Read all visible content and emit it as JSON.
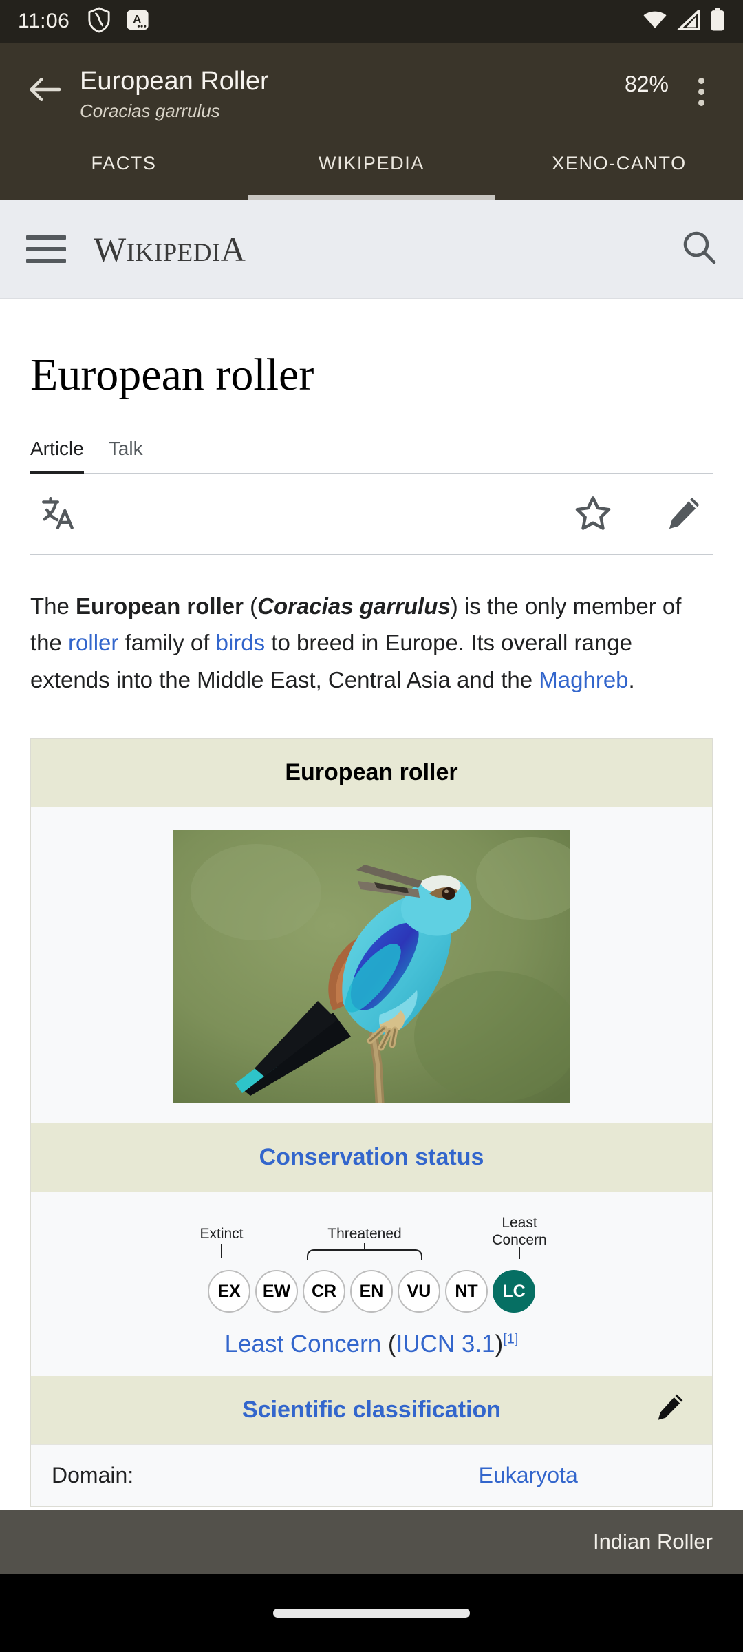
{
  "status_bar": {
    "time": "11:06",
    "icons": [
      "shield-icon",
      "keyboard-language-icon",
      "wifi-icon",
      "cellular-signal-icon",
      "battery-icon"
    ]
  },
  "app_bar": {
    "back_icon": "back-arrow-icon",
    "title": "European Roller",
    "subtitle": "Coracias garrulus",
    "battery_percent": "82%",
    "overflow_icon": "overflow-menu-icon"
  },
  "tabs": [
    {
      "label": "FACTS",
      "selected": false
    },
    {
      "label": "WIKIPEDIA",
      "selected": true
    },
    {
      "label": "XENO-CANTO",
      "selected": false
    }
  ],
  "wiki_header": {
    "menu_icon": "hamburger-menu-icon",
    "wordmark_main": "W",
    "wordmark_rest_a": "IKIPEDI",
    "wordmark_cap": "A",
    "wordmark_text": "WIKIPEDIA",
    "search_icon": "search-icon"
  },
  "article": {
    "title": "European roller",
    "tabs": [
      {
        "label": "Article",
        "selected": true
      },
      {
        "label": "Talk",
        "selected": false
      }
    ],
    "actions": [
      {
        "name": "language-icon",
        "label": "Language"
      },
      {
        "name": "star-icon",
        "label": "Watch"
      },
      {
        "name": "pencil-icon",
        "label": "Edit"
      }
    ],
    "lead": {
      "part1": "The ",
      "bold_name": "European roller",
      "open_paren": " (",
      "bold_italic_name": "Coracias garrulus",
      "close_paren": ") ",
      "part2": "is the only member of the ",
      "link1": "roller",
      "part3": " family of ",
      "link2": "birds",
      "part4": " to breed in Europe. Its overall range extends into the Middle East, Central Asia and the ",
      "link3": "Maghreb",
      "part5": "."
    }
  },
  "infobox": {
    "title": "European roller",
    "image_alt": "European roller perched on a branch",
    "conservation_header": "Conservation status",
    "iucn": {
      "labels": [
        {
          "text": "Extinct",
          "kind": "tick"
        },
        {
          "text": "Threatened",
          "kind": "brace"
        },
        {
          "text": "Least\nConcern",
          "kind": "tick"
        }
      ],
      "label_extinct": "Extinct",
      "label_threatened": "Threatened",
      "label_least_concern_line1": "Least",
      "label_least_concern_line2": "Concern",
      "categories": [
        {
          "code": "EX",
          "active": false
        },
        {
          "code": "EW",
          "active": false
        },
        {
          "code": "CR",
          "active": false
        },
        {
          "code": "EN",
          "active": false
        },
        {
          "code": "VU",
          "active": false
        },
        {
          "code": "NT",
          "active": false
        },
        {
          "code": "LC",
          "active": true
        }
      ],
      "active_color": "#066f63",
      "status_text": "Least Concern",
      "status_source_open": " (",
      "status_source": "IUCN 3.1",
      "status_source_close": ")",
      "status_ref": "[1]"
    },
    "sci_classification_header": "Scientific classification",
    "sci_edit_icon": "pencil-icon",
    "rows": [
      {
        "key": "Domain:",
        "value": "Eukaryota"
      }
    ]
  },
  "overlay": {
    "label": "Indian Roller"
  },
  "nav_bar": {
    "gesture_pill": "home-gesture-pill"
  },
  "colors": {
    "app_bar": "#3a352a",
    "status_bar": "#24221c",
    "wiki_chrome": "#eaecf0",
    "link": "#3366cc",
    "infobox_header": "#e7e8d4",
    "infobox_body": "#f8f9fa",
    "iucn_active": "#066f63"
  }
}
